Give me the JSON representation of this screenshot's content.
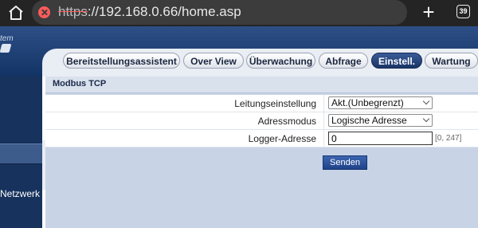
{
  "browser": {
    "url_scheme": "https",
    "url_rest": "://192.168.0.66/home.asp",
    "tab_count": "39",
    "icons": [
      "home-icon",
      "not-secure-icon",
      "new-tab-plus-icon",
      "tab-switcher-icon"
    ]
  },
  "header": {
    "logo_text": "tem"
  },
  "tabs": [
    {
      "label": "Bereitstellungsassistent"
    },
    {
      "label": "Over View"
    },
    {
      "label": "Überwachung"
    },
    {
      "label": "Abfrage"
    },
    {
      "label": "Einstell."
    },
    {
      "label": "Wartung"
    }
  ],
  "sidebar": {
    "items": [
      {
        "label": "Netzwerk"
      }
    ]
  },
  "section": {
    "title": "Modbus TCP"
  },
  "form": {
    "rows": [
      {
        "label": "Leitungseinstellung",
        "value": "Akt.(Unbegrenzt)"
      },
      {
        "label": "Adressmodus",
        "value": "Logische Adresse"
      },
      {
        "label": "Logger-Adresse",
        "value": "0",
        "range": "[0, 247]"
      }
    ],
    "submit_label": "Senden"
  },
  "colors": {
    "header_blue": "#1b3b70",
    "active_tab": "#254a86",
    "send_button": "#2d55a0",
    "content_bg": "#c8d4e6"
  }
}
